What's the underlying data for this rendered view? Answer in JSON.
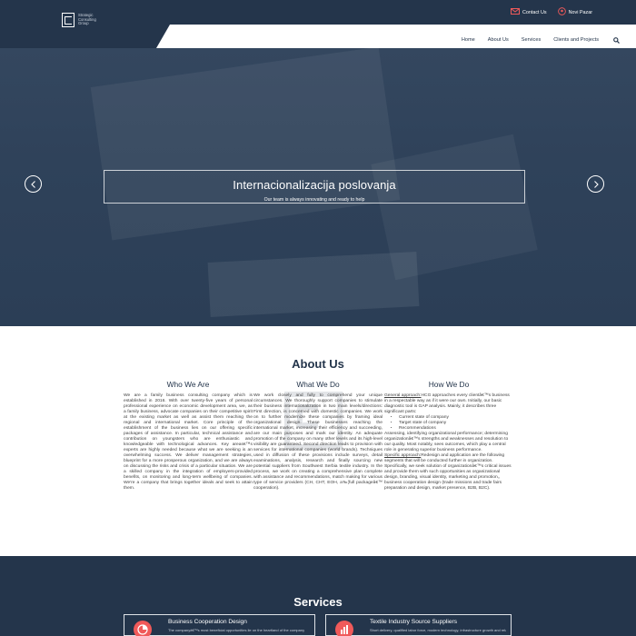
{
  "header": {
    "logo_lines": [
      "Strategic",
      "Consulting",
      "Group"
    ],
    "contact_label": "Contact Us",
    "location_label": "Novi Pazar"
  },
  "nav": {
    "items": [
      {
        "label": "Home"
      },
      {
        "label": "About Us"
      },
      {
        "label": "Services"
      },
      {
        "label": "Clients and Projects"
      }
    ]
  },
  "hero": {
    "title": "Internacionalizacija poslovanja",
    "subtitle": "Our team is always innovating and ready to help"
  },
  "about": {
    "title": "About Us",
    "who": {
      "title": "Who We Are",
      "text": "We are a family business consulting company which is established in 2016. With over twenty-five years of personal professional experience on economic development area, we, as a family business, advocate companies on their competitive spirit at the existing market as well as assist them reaching the regional and international market. Core principle of the establishment of the business lies on our offering specific packages of assistance. In particular, technical assistance and contribution on youngsters who are enthusiastic and knowledgeable with technological advances. Key areas€™s experts are highly needed because what we are seeking is an overwhelming success. We deliver management strategies, blueprint for a more prosperous organization, and we are always on discussing the risks and crisis of a particular situation. We are a skilled company in the integration of employers-provided benefits, on monitoring and long-term wellbeing of companies. We're a company that brings together ideals and seek to attain them."
    },
    "what": {
      "title": "What We Do",
      "text": "We work closely and fully to comprehend your unique circumstances. We thoroughly support companies to stimulate their business internationalization in two main levels/directions: First direction, is concerned with domestic companies. We work on to further modernize these companies by framing ideal organizational design. These businesses reaching the international market, increasing their efficiency and succeeding, are our main purposes and mark our identity. An adequate promotion of the company on many other levels and its high-level visibility are guaranteed. Second direction leads to provision with services for international companies (world brands). Techniques used in diffusion of these provisions include surveys, detail examinations, analysis, research and finally sourcing new potential suppliers from Southwest Serbia textile industry. In the process, we work on creating a comprehensive plan complete with assistance and recommendations, match making for various type of service providers (CH, CHT, EOH, a‰¦full packageâ€™ cooperation)."
    },
    "how": {
      "title": "How We Do",
      "approach1_label": "General approach:",
      "approach1_text": "HCG approaches every clientâ€™s business in a respectable way as if it were our own. Initially, our basic diagnostic tool is GAP analysis. Mainly, it describes three significant parts:",
      "bullets": [
        "Current state of company",
        "Target state of company",
        "Recommendations"
      ],
      "after_bullets": "Assessing, identifying organizational performance; determining organizationâ€™s strengths and weaknesses and resolution to our quality. Most notably, sees outcomes, which play a central role in generating superior business performance.",
      "approach2_label": "Specific approach:",
      "approach2_text": "Redesign and application are the following segments that will be conducted further in organization. Specifically, we seek solution of organizationâ€™s critical issues and provide them with such opportunities as organizational design, branding, visual identity, marketing and promotion,, business cooperation design (trade missions and trade fairs preparation and design, market presence, B2B, B2C)."
    }
  },
  "services": {
    "title": "Services",
    "cards": [
      {
        "title": "Business Cooperation Design",
        "desc": "The companyâ€™s most beneficial opportunities lie on the heartland of the companyâ€™s strength. Appropriate and interactive communication and the"
      },
      {
        "title": "Textile Industry Source Suppliers",
        "desc": "Short delivery, qualified labor force, modern technology, infrastructure growth and relatively high standards for corporate social responsibility (CSR) made Serbia"
      }
    ]
  },
  "colors": {
    "navy": "#24354b",
    "accent": "#f05a5a",
    "hero": "#2f425a"
  }
}
